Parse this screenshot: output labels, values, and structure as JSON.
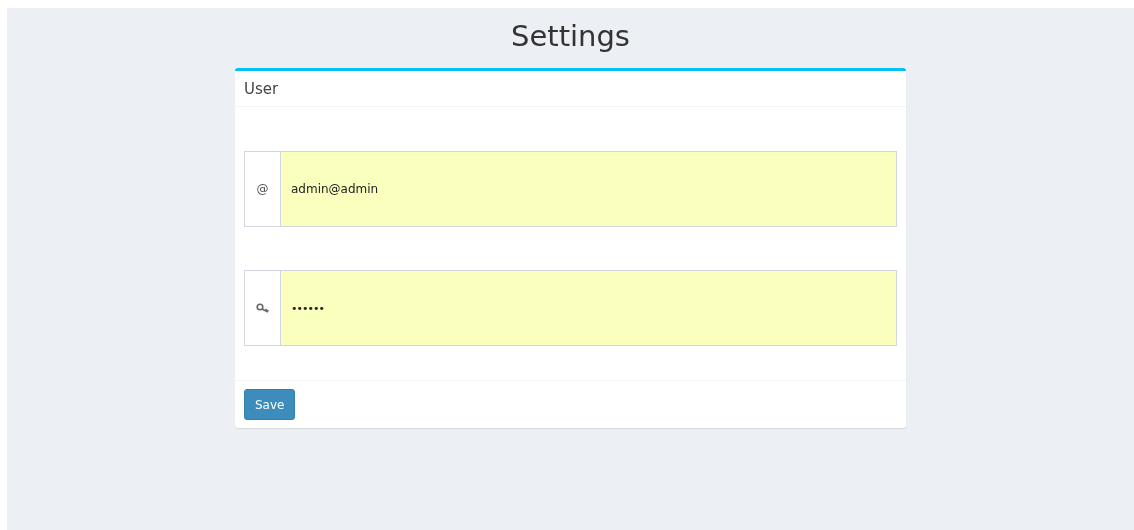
{
  "page": {
    "title": "Settings"
  },
  "card": {
    "title": "User",
    "fields": [
      {
        "kind": "email",
        "addon": "@",
        "value": "admin@admin"
      },
      {
        "kind": "password",
        "value": "••••••"
      }
    ],
    "buttons": [
      {
        "label": "Save"
      }
    ]
  }
}
